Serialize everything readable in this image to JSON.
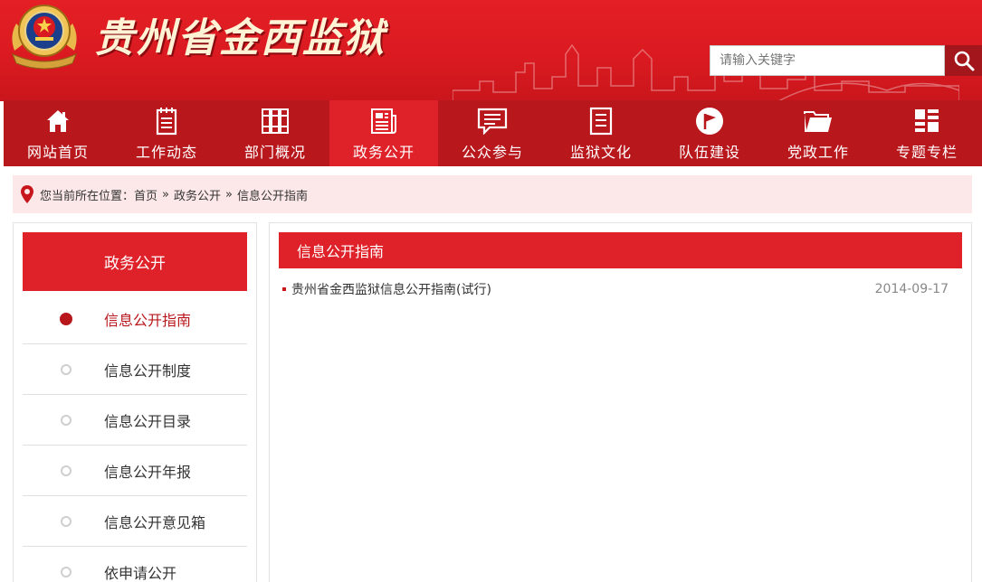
{
  "header": {
    "site_title": "贵州省金西监狱",
    "search_placeholder": "请输入关键字"
  },
  "nav": {
    "items": [
      {
        "label": "网站首页",
        "icon": "home-icon"
      },
      {
        "label": "工作动态",
        "icon": "notepad-icon"
      },
      {
        "label": "部门概况",
        "icon": "books-icon"
      },
      {
        "label": "政务公开",
        "icon": "newspaper-icon",
        "active": true
      },
      {
        "label": "公众参与",
        "icon": "chat-icon"
      },
      {
        "label": "监狱文化",
        "icon": "document-icon"
      },
      {
        "label": "队伍建设",
        "icon": "flag-icon"
      },
      {
        "label": "党政工作",
        "icon": "folder-icon"
      },
      {
        "label": "专题专栏",
        "icon": "grid-icon"
      }
    ]
  },
  "breadcrumb": {
    "prefix": "您当前所在位置：",
    "items": [
      "首页",
      "政务公开",
      "信息公开指南"
    ],
    "separator": "»"
  },
  "sidebar": {
    "title": "政务公开",
    "items": [
      {
        "label": "信息公开指南",
        "active": true
      },
      {
        "label": "信息公开制度"
      },
      {
        "label": "信息公开目录"
      },
      {
        "label": "信息公开年报"
      },
      {
        "label": "信息公开意见箱"
      },
      {
        "label": "依申请公开"
      }
    ]
  },
  "main": {
    "title": "信息公开指南",
    "articles": [
      {
        "title": "贵州省金西监狱信息公开指南(试行)",
        "date": "2014-09-17"
      }
    ]
  },
  "colors": {
    "primary_red": "#df2229",
    "dark_red": "#b8171c",
    "crumb_bg": "#fde8e9"
  }
}
